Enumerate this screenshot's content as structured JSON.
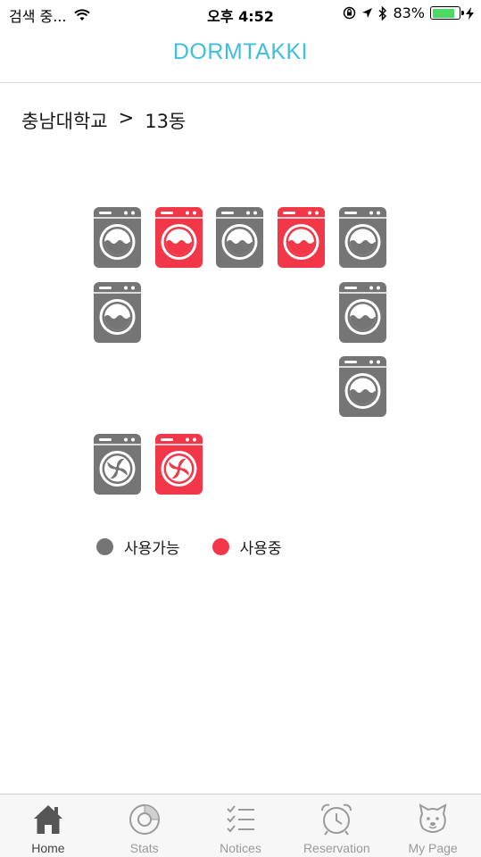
{
  "status_bar": {
    "carrier": "검색 중...",
    "time": "오후 4:52",
    "battery": "83%",
    "battery_level": 0.83,
    "icons": [
      "wifi-icon",
      "orientation-lock-icon",
      "location-arrow-icon",
      "bluetooth-icon",
      "battery-icon",
      "charging-bolt-icon"
    ]
  },
  "nav": {
    "title": "DORMTAKKI"
  },
  "breadcrumb": {
    "school": "충남대학교",
    "separator": ">",
    "building": "13동"
  },
  "machines": [
    {
      "id": "w1",
      "kind": "washer",
      "status": "free"
    },
    {
      "id": "w2",
      "kind": "washer",
      "status": "busy"
    },
    {
      "id": "w3",
      "kind": "washer",
      "status": "free"
    },
    {
      "id": "w4",
      "kind": "washer",
      "status": "busy"
    },
    {
      "id": "w5",
      "kind": "washer",
      "status": "free"
    },
    {
      "id": "w6",
      "kind": "washer",
      "status": "free"
    },
    {
      "id": "w7",
      "kind": "washer",
      "status": "free"
    },
    {
      "id": "w8",
      "kind": "washer",
      "status": "free"
    },
    {
      "id": "d1",
      "kind": "dryer",
      "status": "free"
    },
    {
      "id": "d2",
      "kind": "dryer",
      "status": "busy"
    }
  ],
  "legend": {
    "available": "사용가능",
    "in_use": "사용중"
  },
  "colors": {
    "accent": "#3fbfdc",
    "available": "#757575",
    "in_use": "#f23748"
  },
  "tabs": [
    {
      "label": "Home",
      "icon": "home-icon",
      "active": true
    },
    {
      "label": "Stats",
      "icon": "stats-icon",
      "active": false
    },
    {
      "label": "Notices",
      "icon": "notices-icon",
      "active": false
    },
    {
      "label": "Reservation",
      "icon": "alarm-clock-icon",
      "active": false
    },
    {
      "label": "My Page",
      "icon": "dog-face-icon",
      "active": false
    }
  ]
}
